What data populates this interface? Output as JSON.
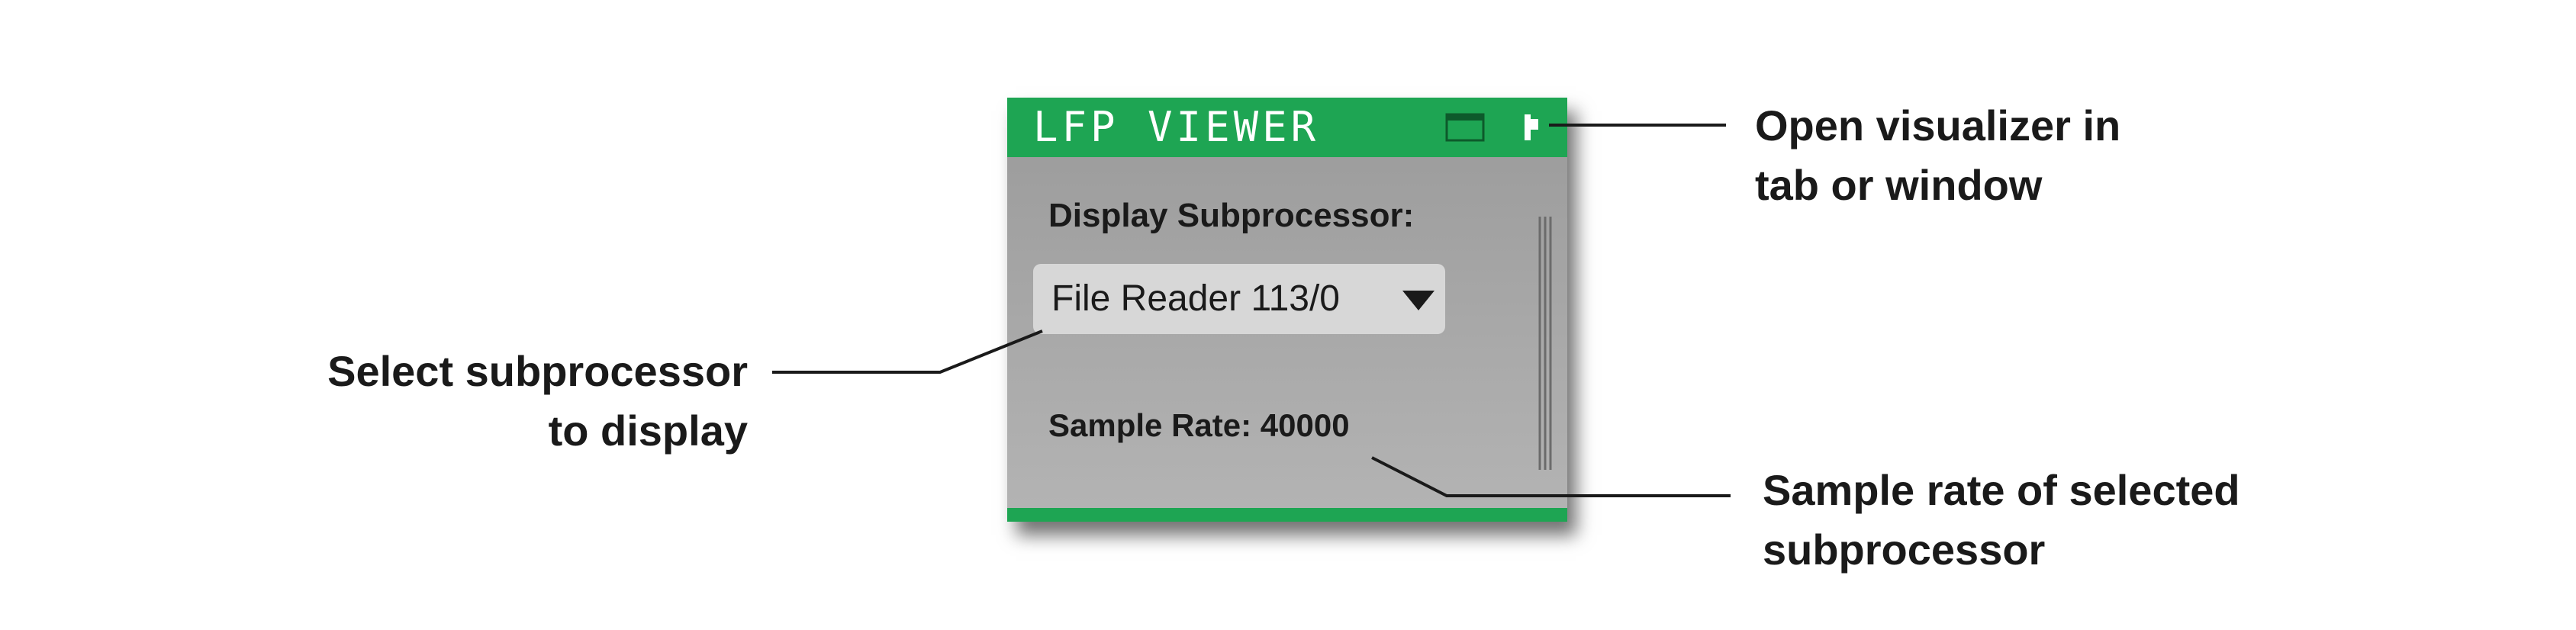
{
  "panel": {
    "title": "LFP VIEWER",
    "subprocessor_label": "Display Subprocessor:",
    "subprocessor_selected": "File Reader 113/0",
    "sample_rate_text": "Sample Rate: 40000",
    "accent_color": "#1ea553",
    "icons": [
      "window-icon",
      "tab-icon",
      "chevron-down-icon"
    ]
  },
  "callouts": {
    "open_visualizer": [
      "Open visualizer in",
      "tab or window"
    ],
    "select_subprocessor": [
      "Select subprocessor",
      "to display"
    ],
    "sample_rate": [
      "Sample rate of selected",
      "subprocessor"
    ]
  }
}
